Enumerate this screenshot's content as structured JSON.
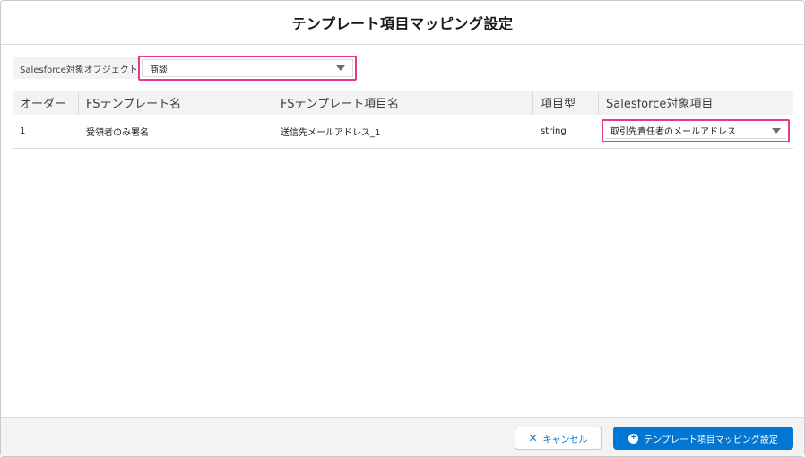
{
  "modal": {
    "title": "テンプレート項目マッピング設定"
  },
  "object_selector": {
    "label": "Salesforce対象オブジェクト",
    "selected": "商談"
  },
  "table": {
    "headers": [
      "オーダー",
      "FSテンプレート名",
      "FSテンプレート項目名",
      "項目型",
      "Salesforce対象項目"
    ],
    "rows": [
      {
        "order": "1",
        "template_name": "受領者のみ署名",
        "template_field": "送信先メールアドレス_1",
        "field_type": "string",
        "sf_field": "取引先責任者のメールアドレス"
      }
    ]
  },
  "footer": {
    "cancel_label": "キャンセル",
    "save_label": "テンプレート項目マッピング設定"
  },
  "colors": {
    "accent": "#0176d3",
    "highlight": "#e5398d"
  },
  "icons": {
    "cancel": "close-icon",
    "save": "add-circle-icon",
    "dropdown": "chevron-down-icon"
  }
}
